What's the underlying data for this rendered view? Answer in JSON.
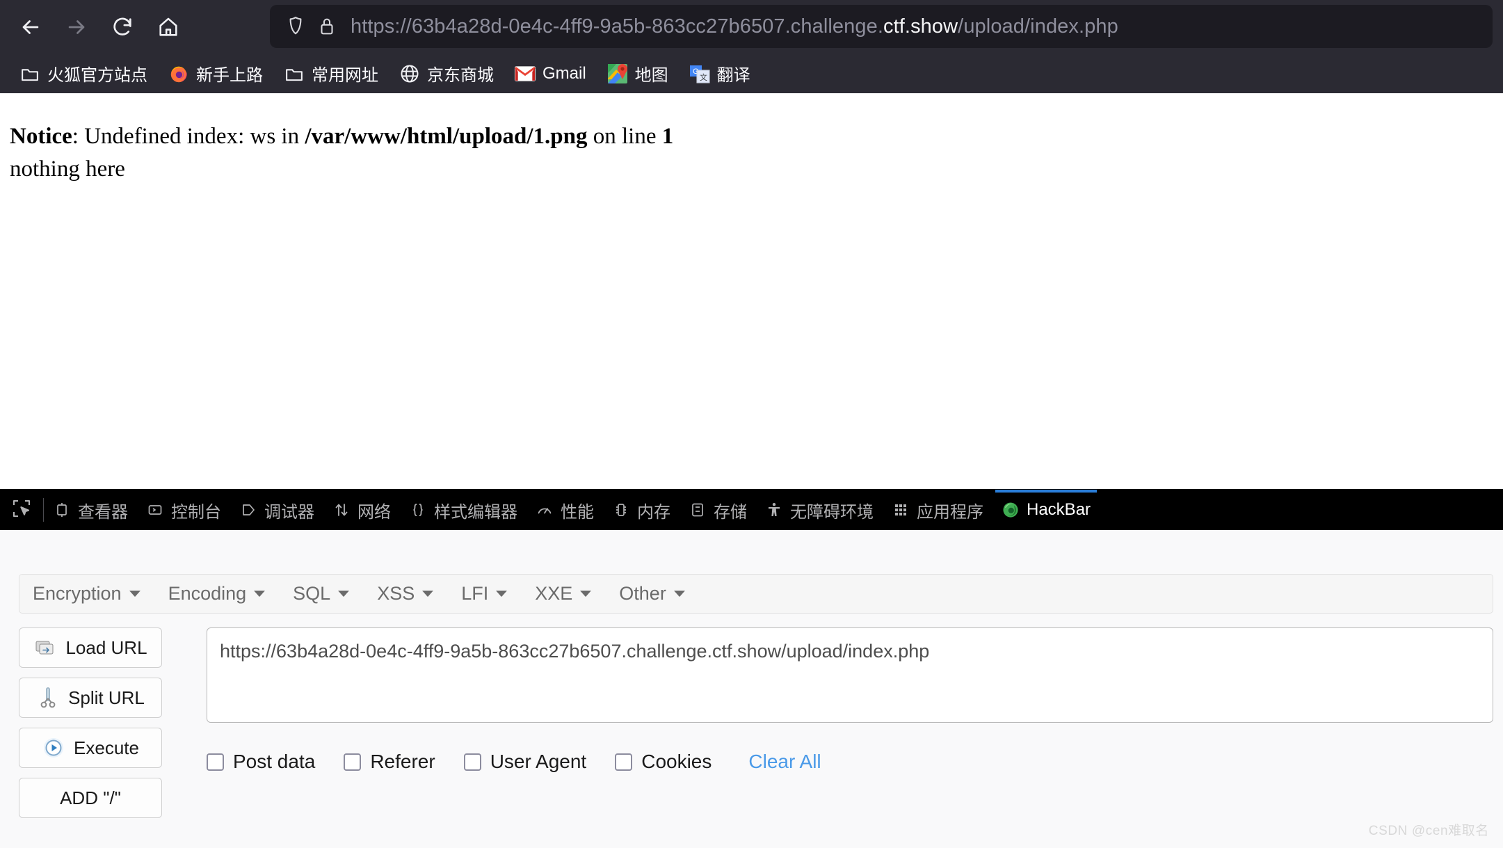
{
  "browser": {
    "nav": {
      "back_label": "Back",
      "forward_label": "Forward",
      "reload_label": "Reload",
      "home_label": "Home"
    },
    "address_bar": {
      "url_prefix": "https://63b4a28d-0e4c-4ff9-9a5b-863cc27b6507.challenge.",
      "url_host_highlight": "ctf.show",
      "url_suffix": "/upload/index.php",
      "full_url": "https://63b4a28d-0e4c-4ff9-9a5b-863cc27b6507.challenge.ctf.show/upload/index.php",
      "shield_icon": "shield-icon",
      "lock_icon": "lock-icon"
    },
    "bookmarks": [
      {
        "label": "火狐官方站点",
        "icon": "folder-icon"
      },
      {
        "label": "新手上路",
        "icon": "firefox-icon"
      },
      {
        "label": "常用网址",
        "icon": "folder-icon"
      },
      {
        "label": "京东商城",
        "icon": "globe-icon"
      },
      {
        "label": "Gmail",
        "icon": "gmail-icon"
      },
      {
        "label": "地图",
        "icon": "google-maps-icon"
      },
      {
        "label": "翻译",
        "icon": "google-translate-icon"
      }
    ]
  },
  "page": {
    "notice_label": "Notice",
    "notice_mid": ": Undefined index: ws in ",
    "notice_path": "/var/www/html/upload/1.png",
    "notice_on_line": " on line ",
    "notice_line_number": "1",
    "body_text": "nothing here"
  },
  "devtools": {
    "picker_icon": "element-picker-icon",
    "tabs": [
      {
        "label": "查看器",
        "icon": "inspector-icon",
        "active": false
      },
      {
        "label": "控制台",
        "icon": "console-icon",
        "active": false
      },
      {
        "label": "调试器",
        "icon": "debugger-icon",
        "active": false
      },
      {
        "label": "网络",
        "icon": "network-icon",
        "active": false
      },
      {
        "label": "样式编辑器",
        "icon": "style-editor-icon",
        "active": false
      },
      {
        "label": "性能",
        "icon": "performance-icon",
        "active": false
      },
      {
        "label": "内存",
        "icon": "memory-icon",
        "active": false
      },
      {
        "label": "存储",
        "icon": "storage-icon",
        "active": false
      },
      {
        "label": "无障碍环境",
        "icon": "accessibility-icon",
        "active": false
      },
      {
        "label": "应用程序",
        "icon": "application-icon",
        "active": false
      },
      {
        "label": "HackBar",
        "icon": "hackbar-icon",
        "active": true
      }
    ],
    "active_tab": "HackBar",
    "active_underline_color": "#2a7dd8"
  },
  "hackbar": {
    "menus": [
      {
        "label": "Encryption"
      },
      {
        "label": "Encoding"
      },
      {
        "label": "SQL"
      },
      {
        "label": "XSS"
      },
      {
        "label": "LFI"
      },
      {
        "label": "XXE"
      },
      {
        "label": "Other"
      }
    ],
    "buttons": [
      {
        "label": "Load URL",
        "icon": "load-url-icon"
      },
      {
        "label": "Split URL",
        "icon": "scissors-icon"
      },
      {
        "label": "Execute",
        "icon": "play-icon"
      },
      {
        "label": "ADD \"/\"",
        "icon": "none"
      }
    ],
    "url_textarea": {
      "value": "https://63b4a28d-0e4c-4ff9-9a5b-863cc27b6507.challenge.ctf.show/upload/index.php",
      "placeholder": ""
    },
    "options": [
      {
        "label": "Post data",
        "checked": false
      },
      {
        "label": "Referer",
        "checked": false
      },
      {
        "label": "User Agent",
        "checked": false
      },
      {
        "label": "Cookies",
        "checked": false
      }
    ],
    "clear_all_label": "Clear All",
    "clear_all_color": "#4a9ae8"
  },
  "watermark": {
    "text": "CSDN @cen难取名"
  }
}
